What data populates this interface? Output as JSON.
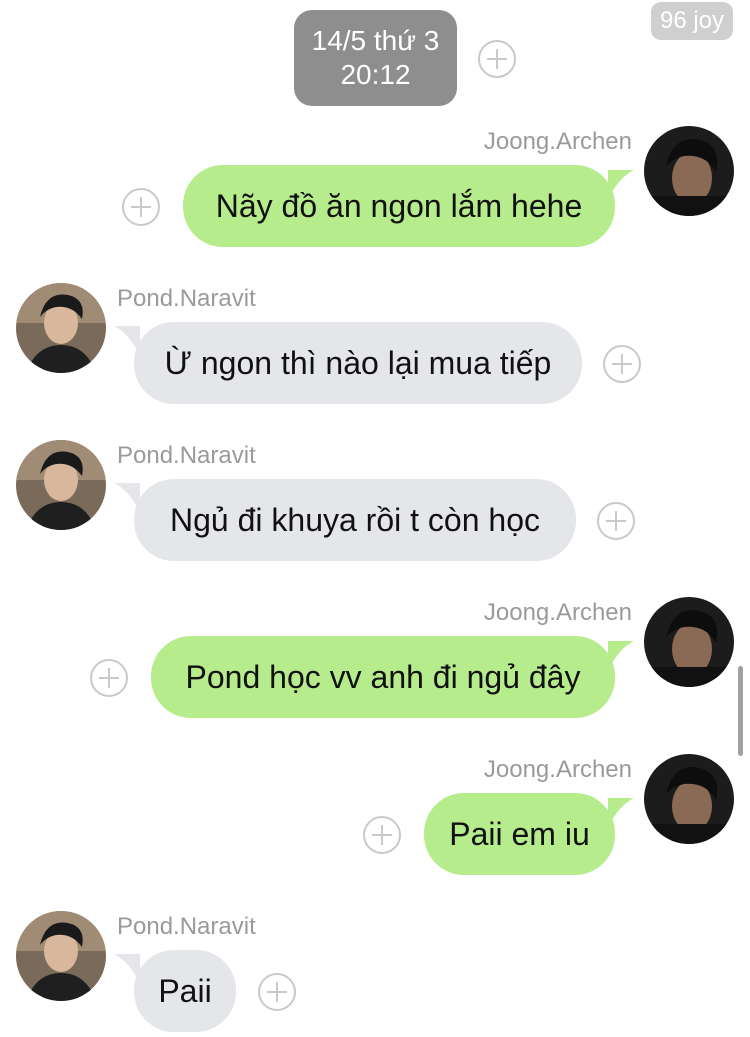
{
  "watermark": "96 joy",
  "date_divider": {
    "date": "14/5 thứ 3",
    "time": "20:12"
  },
  "messages": [
    {
      "sender": "Joong.Archen",
      "text": "Nãy đồ ăn ngon lắm hehe",
      "direction": "sent"
    },
    {
      "sender": "Pond.Naravit",
      "text": "Ừ ngon thì nào lại mua tiếp",
      "direction": "received"
    },
    {
      "sender": "Pond.Naravit",
      "text": "Ngủ đi khuya rồi t còn học",
      "direction": "received"
    },
    {
      "sender": "Joong.Archen",
      "text": "Pond học vv anh đi ngủ đây",
      "direction": "sent"
    },
    {
      "sender": "Joong.Archen",
      "text": "Paii em iu",
      "direction": "sent"
    },
    {
      "sender": "Pond.Naravit",
      "text": "Paii",
      "direction": "received"
    }
  ],
  "colors": {
    "sent_bubble": "#b6ec8c",
    "received_bubble": "#e4e6ea",
    "date_bubble": "#8e8e8e",
    "sender_name": "#9a9a9a"
  },
  "icons": {
    "add": "plus-circle-icon",
    "avatar_joong": "avatar-photo",
    "avatar_pond": "avatar-photo"
  }
}
